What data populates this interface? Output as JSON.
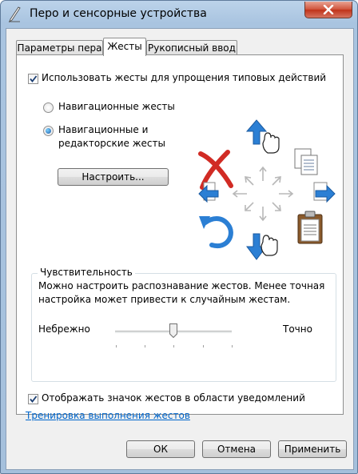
{
  "window": {
    "title": "Перо и сенсорные устройства"
  },
  "tabs": [
    {
      "label": "Параметры пера",
      "active": false
    },
    {
      "label": "Жесты",
      "active": true
    },
    {
      "label": "Рукописный ввод",
      "active": false
    }
  ],
  "gestures": {
    "use_gestures_label": "Использовать жесты для упрощения типовых действий",
    "use_gestures_checked": true,
    "radio_navigation_label": "Навигационные жесты",
    "radio_navigation_edit_label_line1": "Навигационные и",
    "radio_navigation_edit_label_line2": "редакторские жесты",
    "selected_radio": "navigation_edit",
    "configure_button": "Настроить..."
  },
  "sensitivity": {
    "group_title": "Чувствительность",
    "description_line1": "Можно настроить распознавание жестов. Менее точная",
    "description_line2": "настройка может привести к случайным жестам.",
    "left_label": "Небрежно",
    "right_label": "Точно",
    "slider_value": 0.5
  },
  "footer": {
    "show_icon_label": "Отображать значок жестов в области уведомлений",
    "show_icon_checked": true,
    "training_link": "Тренировка выполнения жестов"
  },
  "buttons": {
    "ok": "ОК",
    "cancel": "Отмена",
    "apply": "Применить"
  },
  "icons": {
    "window": "pen-icon",
    "close": "close-icon",
    "gestures": [
      "arrow-up-icon",
      "arrow-down-icon",
      "arrow-left-icon",
      "arrow-right-icon",
      "delete-icon",
      "copy-icon",
      "paste-icon",
      "undo-icon"
    ]
  }
}
